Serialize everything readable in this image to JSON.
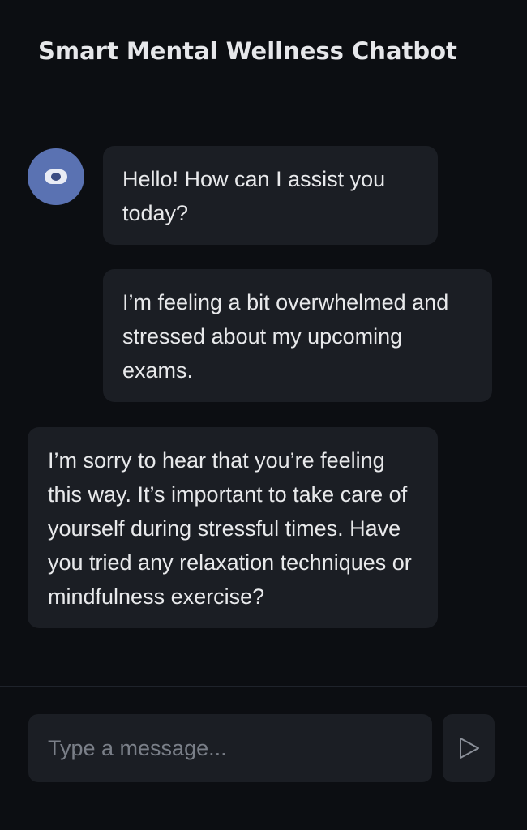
{
  "header": {
    "title": "Smart Mental Wellness Chatbot"
  },
  "messages": [
    {
      "sender": "bot",
      "text": "Hello! How can I assist you today?"
    },
    {
      "sender": "user",
      "text": "I’m feeling a bit overwhelmed and stressed about my upcoming exams."
    },
    {
      "sender": "bot",
      "text": "I’m sorry to hear that you’re feeling this way. It’s important to take care of yourself during stressful times. Have you tried any relaxation techniques or mindfulness exercise?"
    }
  ],
  "composer": {
    "placeholder": "Type a message...",
    "value": "",
    "send_icon": "send-triangle-icon"
  },
  "colors": {
    "background": "#0c0e12",
    "bubble": "#1b1e24",
    "avatar": "#5a72b2",
    "text": "#e8e9eb",
    "placeholder": "#7a7f88"
  }
}
